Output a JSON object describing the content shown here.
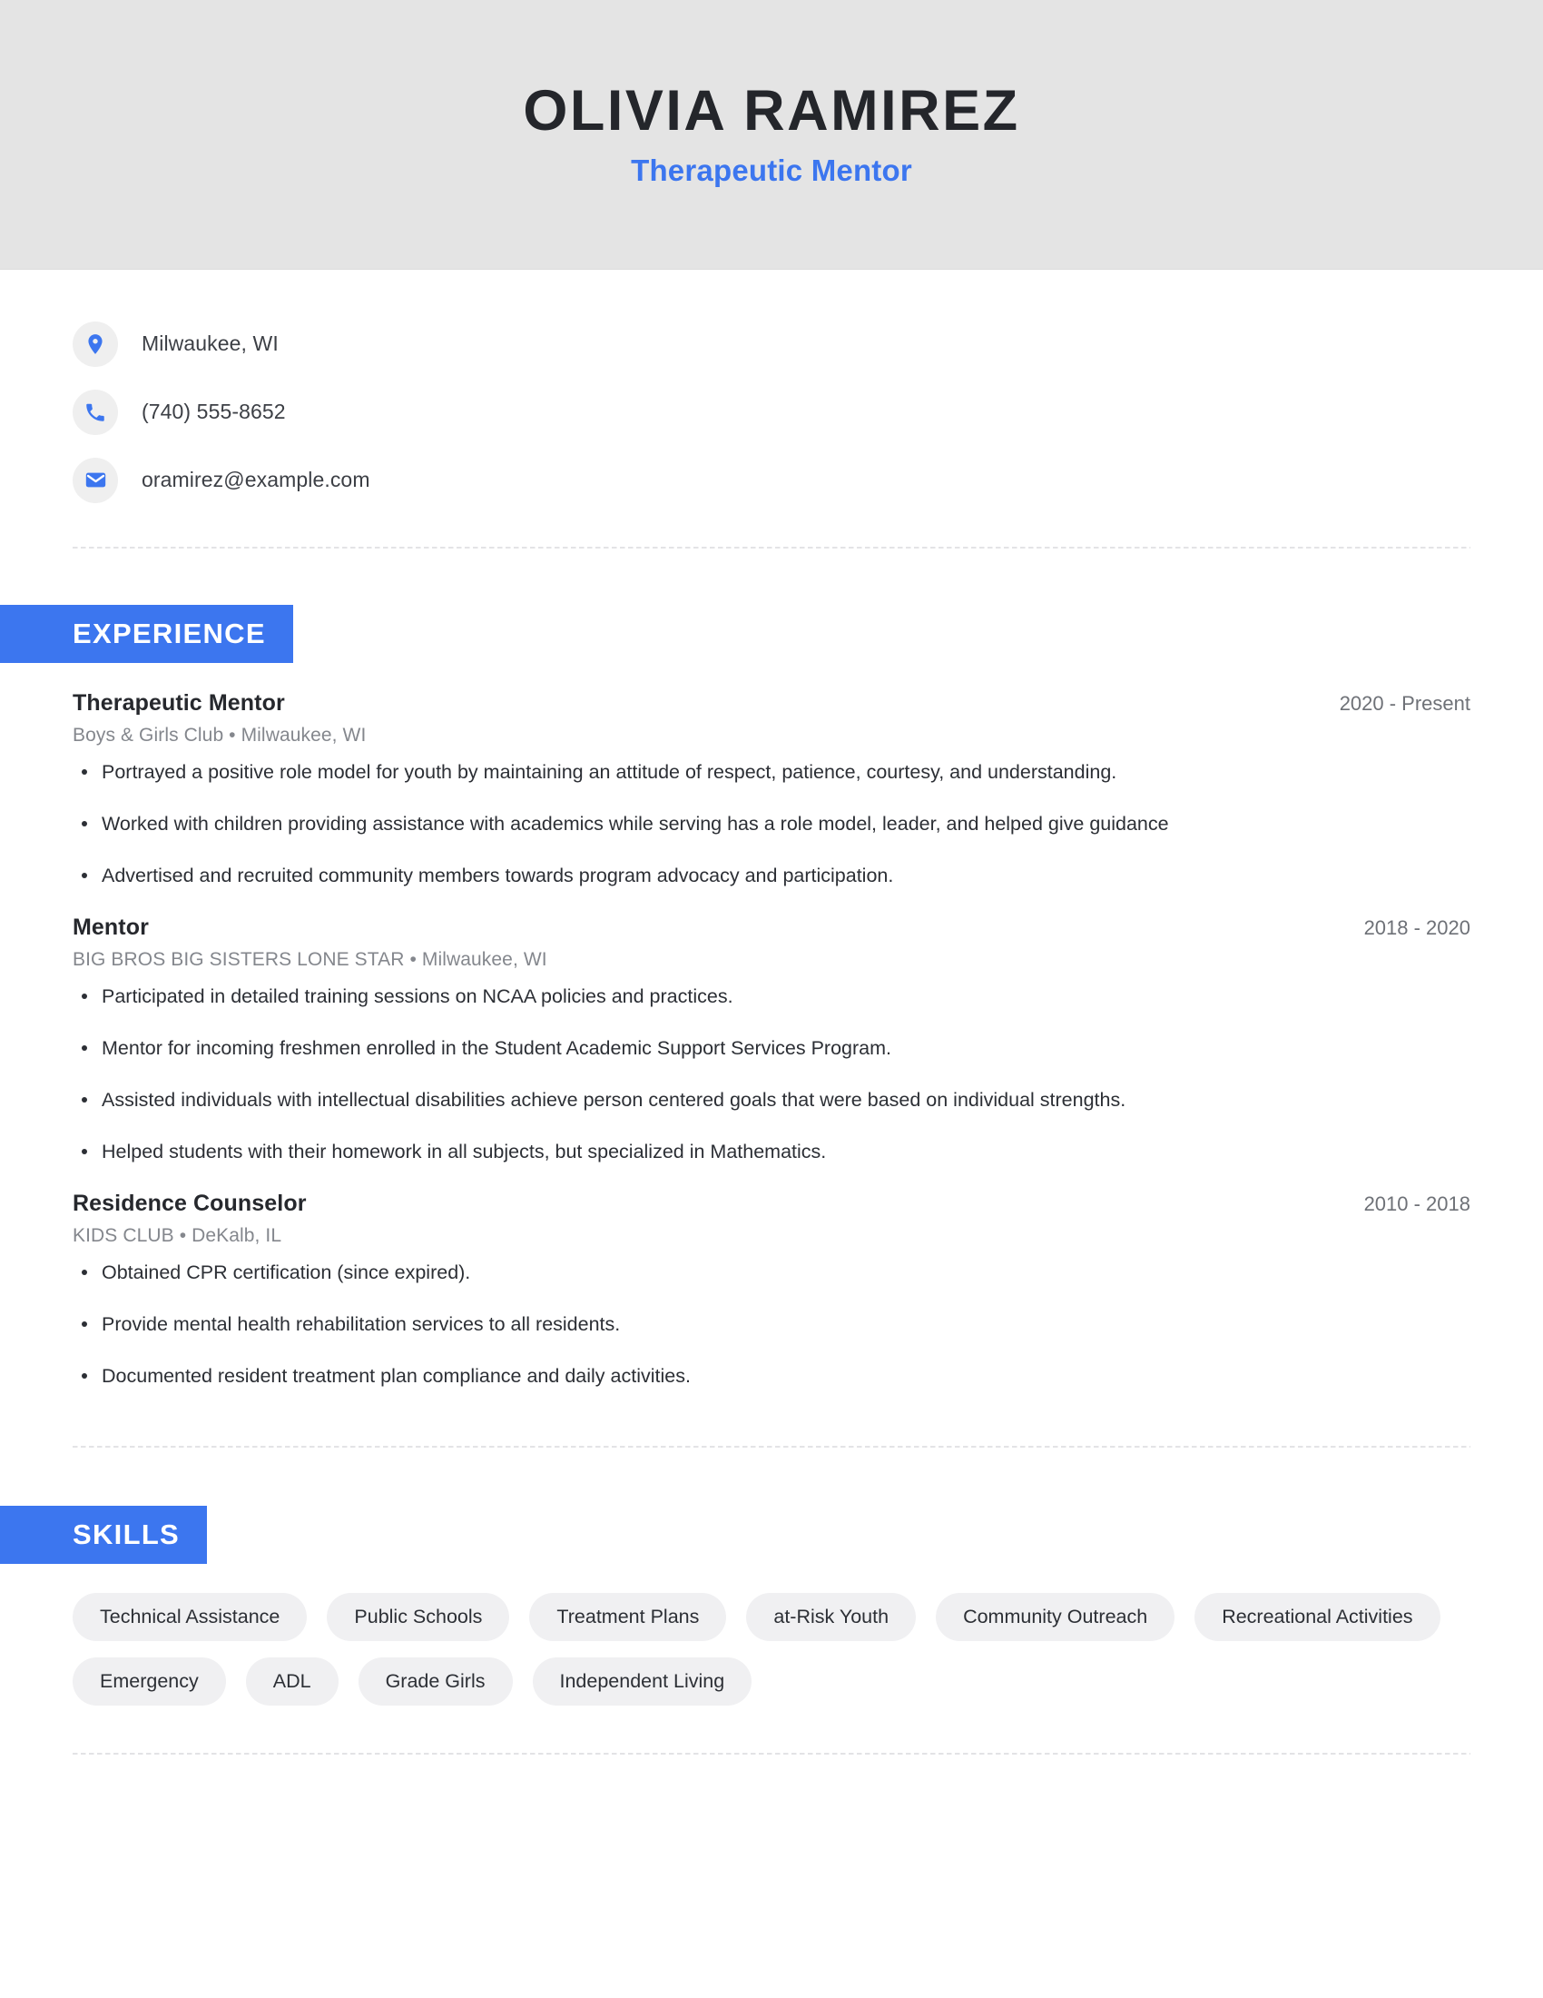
{
  "header": {
    "name": "OLIVIA RAMIREZ",
    "job_title": "Therapeutic Mentor",
    "background_color": "#e4e4e4",
    "accent_color": "#3c76ef"
  },
  "contact": [
    {
      "icon": "location-pin-icon",
      "value": "Milwaukee, WI"
    },
    {
      "icon": "phone-icon",
      "value": "(740) 555-8652"
    },
    {
      "icon": "email-icon",
      "value": "oramirez@example.com"
    }
  ],
  "experience": {
    "section_label": "EXPERIENCE",
    "jobs": [
      {
        "role": "Therapeutic Mentor",
        "dates": "2020 - Present",
        "company": "Boys & Girls Club  •  Milwaukee, WI",
        "bullets": [
          "Portrayed a positive role model for youth by maintaining an attitude of respect, patience, courtesy, and understanding.",
          "Worked with children providing assistance with academics while serving has a role model, leader, and helped give guidance",
          "Advertised and recruited community members towards program advocacy and participation."
        ]
      },
      {
        "role": "Mentor",
        "dates": "2018 - 2020",
        "company": "BIG BROS BIG SISTERS LONE STAR  •  Milwaukee, WI",
        "bullets": [
          "Participated in detailed training sessions on NCAA policies and practices.",
          "Mentor for incoming freshmen enrolled in the Student Academic Support Services Program.",
          "Assisted individuals with intellectual disabilities achieve person centered goals that were based on individual strengths.",
          "Helped students with their homework in all subjects, but specialized in Mathematics."
        ]
      },
      {
        "role": "Residence Counselor",
        "dates": "2010 - 2018",
        "company": "KIDS CLUB  •  DeKalb, IL",
        "bullets": [
          "Obtained CPR certification (since expired).",
          "Provide mental health rehabilitation services to all residents.",
          "Documented resident treatment plan compliance and daily activities."
        ]
      }
    ]
  },
  "skills": {
    "section_label": "SKILLS",
    "items": [
      "Technical Assistance",
      "Public Schools",
      "Treatment Plans",
      "at-Risk Youth",
      "Community Outreach",
      "Recreational Activities",
      "Emergency",
      "ADL",
      "Grade Girls",
      "Independent Living"
    ]
  }
}
